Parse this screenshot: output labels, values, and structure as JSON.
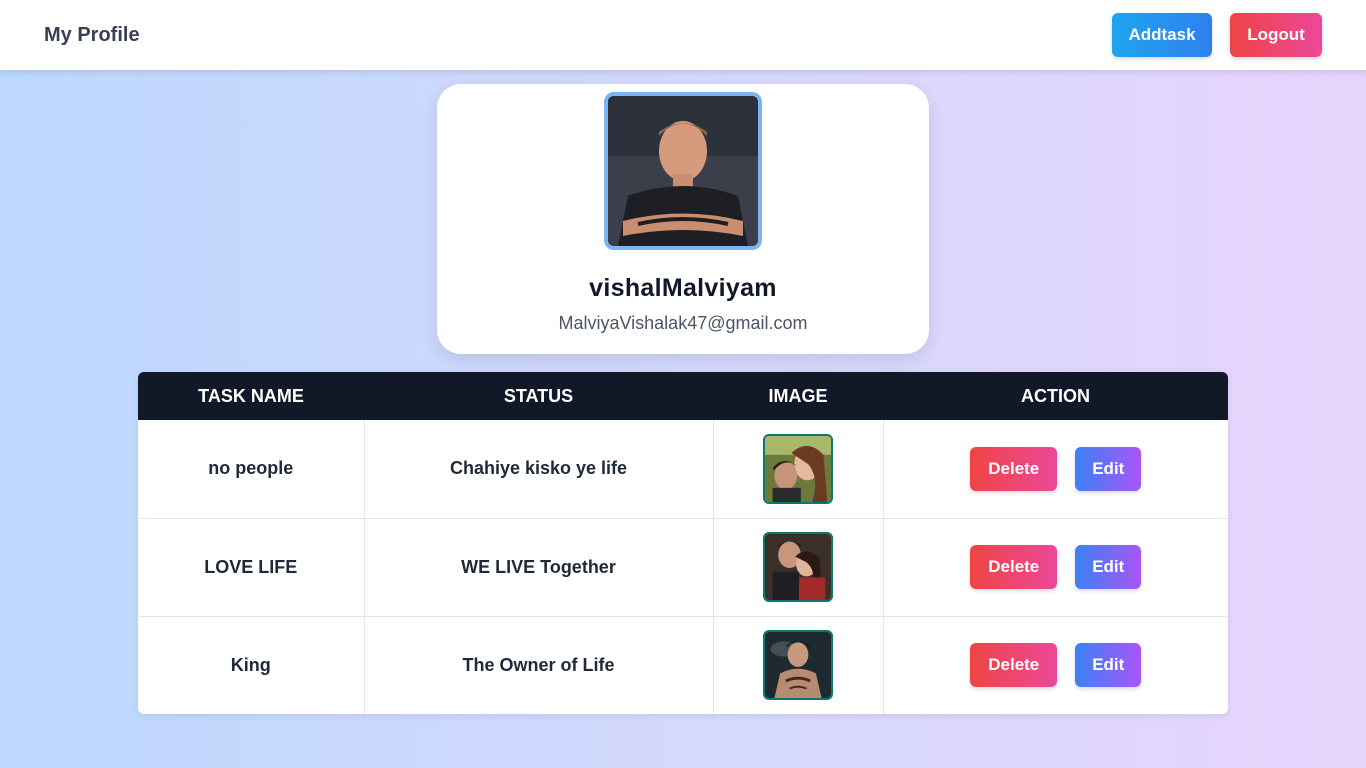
{
  "header": {
    "title": "My Profile",
    "addtask_label": "Addtask",
    "logout_label": "Logout"
  },
  "profile": {
    "username": "vishalMalviyam",
    "email": "MalviyaVishalak47@gmail.com",
    "avatar_icon": "profile-photo"
  },
  "table": {
    "headers": [
      "TASK NAME",
      "STATUS",
      "IMAGE",
      "ACTION"
    ],
    "rows": [
      {
        "task_name": "no people",
        "status": "Chahiye kisko ye life",
        "image_icon": "task-image",
        "delete_label": "Delete",
        "edit_label": "Edit"
      },
      {
        "task_name": "LOVE LIFE",
        "status": "WE LIVE Together",
        "image_icon": "task-image",
        "delete_label": "Delete",
        "edit_label": "Edit"
      },
      {
        "task_name": "King",
        "status": "The Owner of Life",
        "image_icon": "task-image",
        "delete_label": "Delete",
        "edit_label": "Edit"
      }
    ]
  },
  "colors": {
    "header_bg": "#111827",
    "delete_gradient": [
      "#ef4444",
      "#ec4899"
    ],
    "edit_gradient": [
      "#3b82f6",
      "#a855f7"
    ],
    "addtask_gradient": [
      "#1ea5ef",
      "#2f80ed"
    ]
  }
}
